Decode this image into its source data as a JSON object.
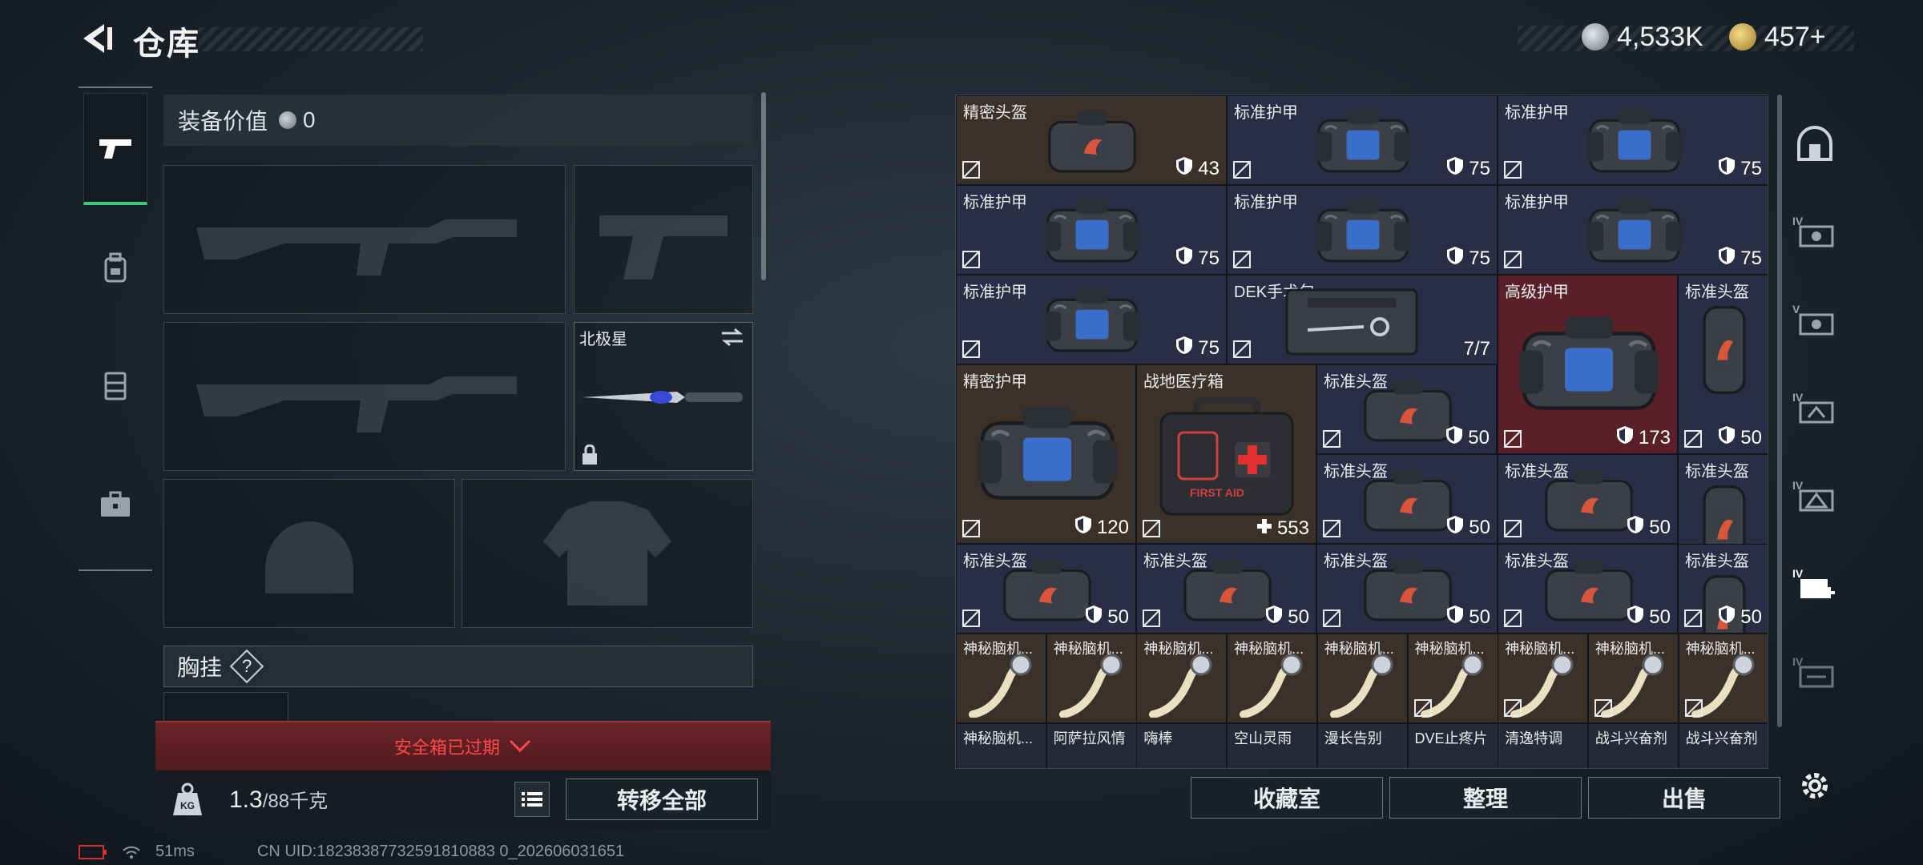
{
  "header": {
    "title": "仓库",
    "currency1": "4,533K",
    "currency2": "457+"
  },
  "equipment": {
    "value_label": "装备价值",
    "value": "0",
    "melee_name": "北极星",
    "chest_label": "胸挂",
    "chest_hint": "?"
  },
  "safe_box": "安全箱已过期",
  "footer_left": {
    "weight": "1.3",
    "weight_max": "/88千克",
    "transfer_all": "转移全部",
    "weight_icon": "KG"
  },
  "status": {
    "ping": "51ms",
    "uid": "CN UID:18238387732591810883 0_202606031651"
  },
  "items": [
    {
      "name": "精密头盔",
      "value": "43"
    },
    {
      "name": "标准护甲",
      "value": "75"
    },
    {
      "name": "标准护甲",
      "value": "75"
    },
    {
      "name": "标准护甲",
      "value": "75"
    },
    {
      "name": "标准护甲",
      "value": "75"
    },
    {
      "name": "标准护甲",
      "value": "75"
    },
    {
      "name": "标准护甲",
      "value": "75"
    },
    {
      "name": "DEK手术包",
      "value": "7/7"
    },
    {
      "name": "高级护甲",
      "value": "173"
    },
    {
      "name": "标准头盔",
      "value": "50"
    },
    {
      "name": "精密护甲",
      "value": "120"
    },
    {
      "name": "战地医疗箱",
      "value": "553"
    },
    {
      "name": "标准头盔",
      "value": "50"
    },
    {
      "name": "标准头盔",
      "value": "50"
    },
    {
      "name": "标准头盔",
      "value": "50"
    },
    {
      "name": "标准头盔",
      "value": "50"
    },
    {
      "name": "标准头盔",
      "value": "50"
    },
    {
      "name": "标准头盔",
      "value": "50"
    },
    {
      "name": "标准头盔",
      "value": "50"
    },
    {
      "name": "标准头盔",
      "value": "50"
    },
    {
      "name": "标准头盔",
      "value": "50"
    }
  ],
  "mystery": [
    "神秘脑机...",
    "神秘脑机...",
    "神秘脑机...",
    "神秘脑机...",
    "神秘脑机...",
    "神秘脑机...",
    "神秘脑机...",
    "神秘脑机...",
    "神秘脑机..."
  ],
  "bottom_row": [
    "神秘脑机...",
    "阿萨拉风情",
    "嗨棒",
    "空山灵雨",
    "漫长告别",
    "DVE止疼片",
    "清逸特调",
    "战斗兴奋剂",
    "战斗兴奋剂"
  ],
  "buttons": {
    "collection": "收藏室",
    "organize": "整理",
    "sell": "出售"
  },
  "colors": {
    "accent_green": "#3ec77a",
    "alert_red": "#ff4a4a",
    "armor_bg": "#2a2e44",
    "helmet_brown": "#3b3128",
    "rare_red": "#5a2028"
  }
}
